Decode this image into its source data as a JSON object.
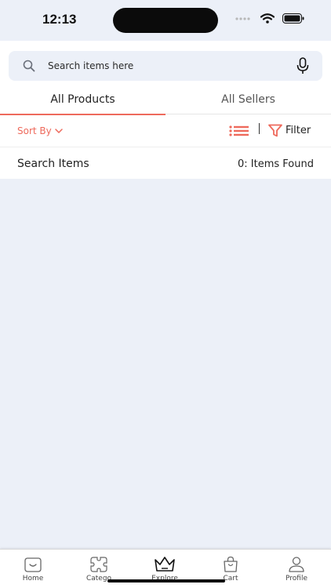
{
  "status_bar": {
    "time": "12:13"
  },
  "search": {
    "placeholder": "Search items here"
  },
  "tabs": [
    {
      "label": "All Products",
      "active": true
    },
    {
      "label": "All Sellers",
      "active": false
    }
  ],
  "filters": {
    "sort_label": "Sort By",
    "filter_label": "Filter"
  },
  "results": {
    "title": "Search Items",
    "count_text": "0: Items Found"
  },
  "bottom_nav": [
    {
      "label": "Home",
      "icon": "home-icon"
    },
    {
      "label": "Catego",
      "icon": "categories-icon"
    },
    {
      "label": "Explore",
      "icon": "crown-icon"
    },
    {
      "label": "Cart",
      "icon": "bag-icon"
    },
    {
      "label": "Profile",
      "icon": "profile-icon"
    }
  ],
  "colors": {
    "accent": "#ee6a5c",
    "background": "#ecf0f8"
  }
}
